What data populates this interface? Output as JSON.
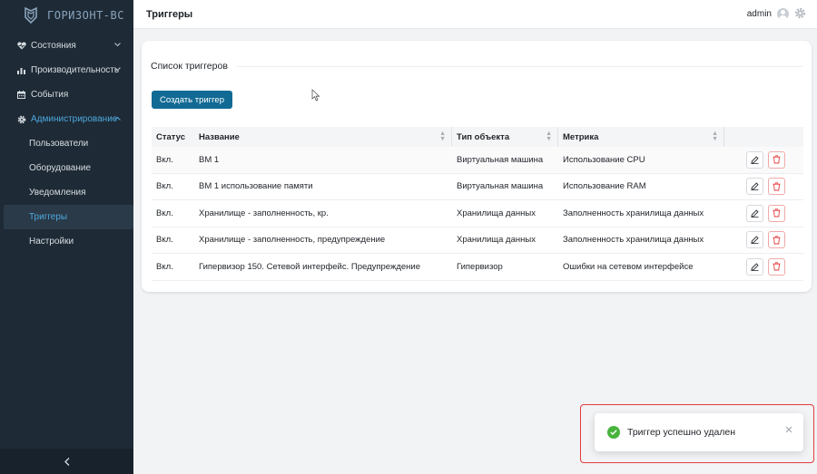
{
  "brand": {
    "name": "ГОРИЗОНТ-ВС"
  },
  "sidebar": {
    "items": [
      {
        "label": "Состояния",
        "icon": "heart-pulse-icon",
        "expandable": true
      },
      {
        "label": "Производительность",
        "icon": "bar-chart-icon",
        "expandable": true
      },
      {
        "label": "События",
        "icon": "calendar-icon",
        "expandable": false
      },
      {
        "label": "Администрирование",
        "icon": "gear-icon",
        "expandable": true,
        "expanded": true
      }
    ],
    "admin_subitems": [
      {
        "label": "Пользователи"
      },
      {
        "label": "Оборудование"
      },
      {
        "label": "Уведомления"
      },
      {
        "label": "Триггеры",
        "selected": true
      },
      {
        "label": "Настройки"
      }
    ],
    "collapse_icon": "chevron-left-icon"
  },
  "header": {
    "title": "Триггеры",
    "user": "admin"
  },
  "card": {
    "title": "Список триггеров",
    "create_button": "Создать триггер"
  },
  "table": {
    "columns": [
      "Статус",
      "Название",
      "Тип объекта",
      "Метрика"
    ],
    "rows": [
      {
        "status": "Вкл.",
        "name": "ВМ 1",
        "object_type": "Виртуальная машина",
        "metric": "Использование CPU"
      },
      {
        "status": "Вкл.",
        "name": "ВМ 1 использование памяти",
        "object_type": "Виртуальная машина",
        "metric": "Использование RAM"
      },
      {
        "status": "Вкл.",
        "name": "Хранилище - заполненность, кр.",
        "object_type": "Хранилища данных",
        "metric": "Заполненность хранилища данных"
      },
      {
        "status": "Вкл.",
        "name": "Хранилище - заполненность, предупреждение",
        "object_type": "Хранилища данных",
        "metric": "Заполненность хранилища данных"
      },
      {
        "status": "Вкл.",
        "name": "Гипервизор 150. Сетевой интерфейс. Предупреждение",
        "object_type": "Гипервизор",
        "metric": "Ошибки на сетевом интерфейсе"
      }
    ]
  },
  "toast": {
    "message": "Триггер успешно удален"
  },
  "colors": {
    "sidebar": "#1e2a35",
    "accent": "#4ea8de",
    "primary_button": "#116a94",
    "danger": "#e33b3b",
    "success": "#47b33b"
  }
}
